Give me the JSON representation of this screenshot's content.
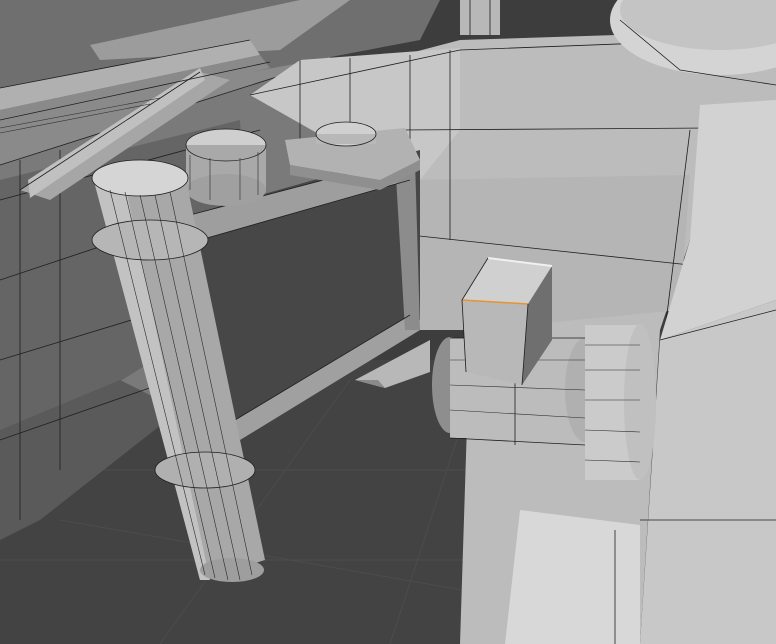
{
  "viewport": {
    "mode": "object-edit",
    "shading": "solid",
    "overlay": "wireframe",
    "selection": "single-cube-top-edge"
  },
  "colors": {
    "background": "#3d3d3d",
    "grid_floor": "#434343",
    "grid_line": "#4c4c4c",
    "face_light": "#c9c9c9",
    "face_mid": "#a9a9a9",
    "face_dark": "#6e6e6e",
    "face_shadow": "#505050",
    "wire": "#1e1e1e",
    "selected_edge": "#f0f0f0",
    "selected_edge_accent": "#e7932f"
  },
  "objects": [
    "hull-panel-left",
    "hull-panel-right",
    "roof-plate",
    "cylinder-post-front",
    "cylinder-post-rear",
    "link-plate",
    "bolt-head-top",
    "cube-selected",
    "cylinder-axle",
    "turret-base",
    "right-block"
  ]
}
